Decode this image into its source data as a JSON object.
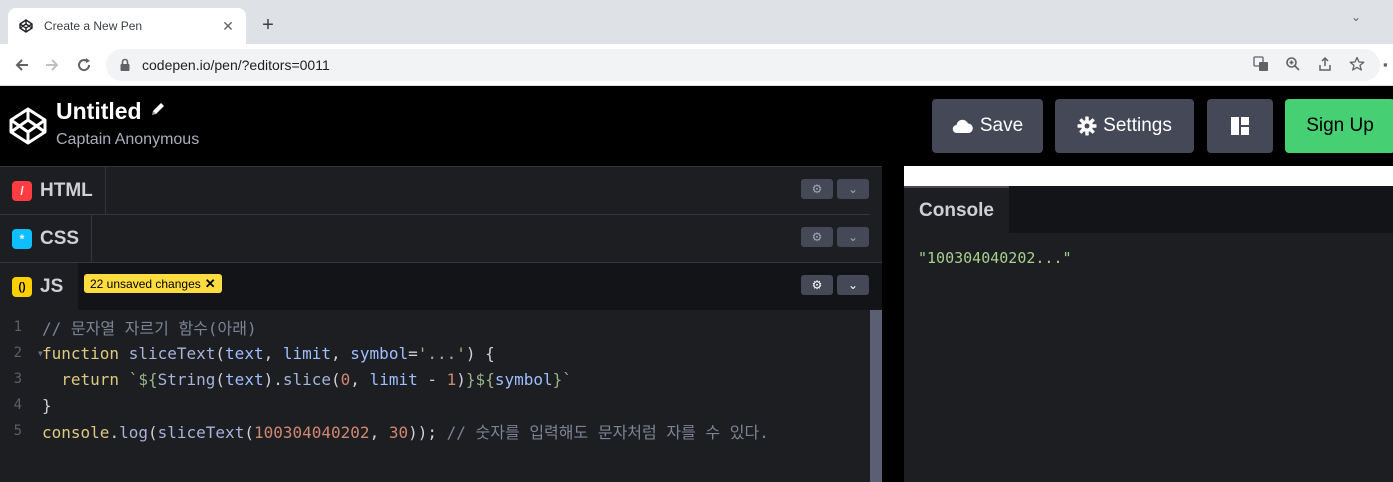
{
  "browser": {
    "tab_title": "Create a New Pen",
    "new_tab_label": "+",
    "tab_menu_label": "⌄",
    "url": "codepen.io/pen/?editors=0011"
  },
  "header": {
    "pen_title": "Untitled",
    "author": "Captain Anonymous",
    "buttons": {
      "save": "Save",
      "settings": "Settings",
      "signup": "Sign Up"
    }
  },
  "editors": {
    "html": {
      "name": "HTML",
      "icon_glyph": "/",
      "icon_color": "#ff3c41"
    },
    "css": {
      "name": "CSS",
      "icon_glyph": "*",
      "icon_color": "#0ebeff"
    },
    "js": {
      "name": "JS",
      "icon_glyph": "()",
      "icon_color": "#fcd000",
      "unsaved_label": "22 unsaved changes",
      "unsaved_close": "✕"
    }
  },
  "code": {
    "line_numbers": [
      "1",
      "2",
      "3",
      "4",
      "5"
    ],
    "line1_comment": "// 문자열 자르기 함수(아래)",
    "line2": {
      "kw": "function",
      "fn": "sliceText",
      "open": "(",
      "p1": "text",
      "comma1": ", ",
      "p2": "limit",
      "comma2": ", ",
      "p3": "symbol",
      "eq": "=",
      "str": "'...'",
      "close": ") {"
    },
    "line3": {
      "kw": "return",
      "tick_open": "`${",
      "fn": "String",
      "p_open": "(",
      "arg": "text",
      "dot_slice": ").",
      "slice": "slice",
      "args_open": "(",
      "n0": "0",
      "comma": ", ",
      "limit": "limit",
      "minus": " - ",
      "n1": "1",
      "args_close": ")",
      "tpl_mid": "}${",
      "symbol": "symbol",
      "tick_close": "}`"
    },
    "line4": "}",
    "line5": {
      "console": "console",
      "dot": ".",
      "log": "log",
      "open": "(",
      "fn": "sliceText",
      "open2": "(",
      "num": "100304040202",
      "comma": ", ",
      "n30": "30",
      "close": "));",
      "comment": "// 숫자를 입력해도 문자처럼 자를 수 있다."
    }
  },
  "console": {
    "title": "Console",
    "output": "\"100304040202...\""
  },
  "colors": {
    "accent_green": "#47cf73",
    "button_bg": "#444857",
    "unsaved_badge": "#ffdd40"
  }
}
